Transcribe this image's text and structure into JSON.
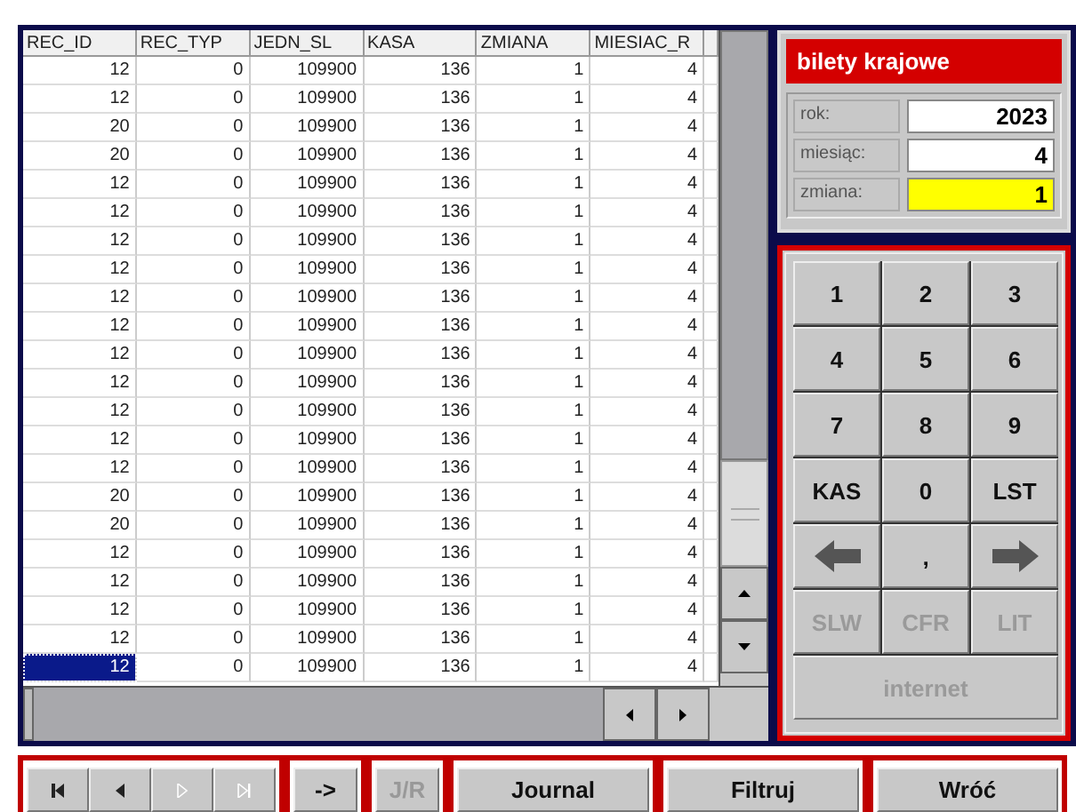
{
  "table": {
    "columns": [
      "REC_ID",
      "REC_TYP",
      "JEDN_SL",
      "KASA",
      "ZMIANA",
      "MIESIAC_R"
    ],
    "rows": [
      {
        "cells": [
          "12",
          "0",
          "109900",
          "136",
          "1",
          "4"
        ],
        "selected": false
      },
      {
        "cells": [
          "12",
          "0",
          "109900",
          "136",
          "1",
          "4"
        ],
        "selected": false
      },
      {
        "cells": [
          "20",
          "0",
          "109900",
          "136",
          "1",
          "4"
        ],
        "selected": false
      },
      {
        "cells": [
          "20",
          "0",
          "109900",
          "136",
          "1",
          "4"
        ],
        "selected": false
      },
      {
        "cells": [
          "12",
          "0",
          "109900",
          "136",
          "1",
          "4"
        ],
        "selected": false
      },
      {
        "cells": [
          "12",
          "0",
          "109900",
          "136",
          "1",
          "4"
        ],
        "selected": false
      },
      {
        "cells": [
          "12",
          "0",
          "109900",
          "136",
          "1",
          "4"
        ],
        "selected": false
      },
      {
        "cells": [
          "12",
          "0",
          "109900",
          "136",
          "1",
          "4"
        ],
        "selected": false
      },
      {
        "cells": [
          "12",
          "0",
          "109900",
          "136",
          "1",
          "4"
        ],
        "selected": false
      },
      {
        "cells": [
          "12",
          "0",
          "109900",
          "136",
          "1",
          "4"
        ],
        "selected": false
      },
      {
        "cells": [
          "12",
          "0",
          "109900",
          "136",
          "1",
          "4"
        ],
        "selected": false
      },
      {
        "cells": [
          "12",
          "0",
          "109900",
          "136",
          "1",
          "4"
        ],
        "selected": false
      },
      {
        "cells": [
          "12",
          "0",
          "109900",
          "136",
          "1",
          "4"
        ],
        "selected": false
      },
      {
        "cells": [
          "12",
          "0",
          "109900",
          "136",
          "1",
          "4"
        ],
        "selected": false
      },
      {
        "cells": [
          "12",
          "0",
          "109900",
          "136",
          "1",
          "4"
        ],
        "selected": false
      },
      {
        "cells": [
          "20",
          "0",
          "109900",
          "136",
          "1",
          "4"
        ],
        "selected": false
      },
      {
        "cells": [
          "20",
          "0",
          "109900",
          "136",
          "1",
          "4"
        ],
        "selected": false
      },
      {
        "cells": [
          "12",
          "0",
          "109900",
          "136",
          "1",
          "4"
        ],
        "selected": false
      },
      {
        "cells": [
          "12",
          "0",
          "109900",
          "136",
          "1",
          "4"
        ],
        "selected": false
      },
      {
        "cells": [
          "12",
          "0",
          "109900",
          "136",
          "1",
          "4"
        ],
        "selected": false
      },
      {
        "cells": [
          "12",
          "0",
          "109900",
          "136",
          "1",
          "4"
        ],
        "selected": false
      },
      {
        "cells": [
          "12",
          "0",
          "109900",
          "136",
          "1",
          "4"
        ],
        "selected": true
      }
    ]
  },
  "panel": {
    "title": "bilety krajowe",
    "fields": [
      {
        "label": "rok:",
        "value": "2023",
        "highlighted": false
      },
      {
        "label": "miesiąc:",
        "value": "4",
        "highlighted": false
      },
      {
        "label": "zmiana:",
        "value": "1",
        "highlighted": true
      }
    ]
  },
  "keypad": [
    {
      "kind": "text",
      "label": "1",
      "disabled": false
    },
    {
      "kind": "text",
      "label": "2",
      "disabled": false
    },
    {
      "kind": "text",
      "label": "3",
      "disabled": false
    },
    {
      "kind": "text",
      "label": "4",
      "disabled": false
    },
    {
      "kind": "text",
      "label": "5",
      "disabled": false
    },
    {
      "kind": "text",
      "label": "6",
      "disabled": false
    },
    {
      "kind": "text",
      "label": "7",
      "disabled": false
    },
    {
      "kind": "text",
      "label": "8",
      "disabled": false
    },
    {
      "kind": "text",
      "label": "9",
      "disabled": false
    },
    {
      "kind": "text",
      "label": "KAS",
      "disabled": false
    },
    {
      "kind": "text",
      "label": "0",
      "disabled": false
    },
    {
      "kind": "text",
      "label": "LST",
      "disabled": false
    },
    {
      "kind": "left",
      "disabled": false
    },
    {
      "kind": "text",
      "label": ",",
      "disabled": false
    },
    {
      "kind": "right",
      "disabled": false
    },
    {
      "kind": "text",
      "label": "SLW",
      "disabled": true
    },
    {
      "kind": "text",
      "label": "CFR",
      "disabled": true
    },
    {
      "kind": "text",
      "label": "LIT",
      "disabled": true
    },
    {
      "kind": "wide",
      "label": "internet",
      "disabled": true
    }
  ],
  "navigator": [
    {
      "kind": "first",
      "disabled": false
    },
    {
      "kind": "prev",
      "disabled": false
    },
    {
      "kind": "next",
      "disabled": true
    },
    {
      "kind": "last",
      "disabled": true
    }
  ],
  "buttons": [
    {
      "label": "->",
      "disabled": false
    },
    {
      "label": "J/R",
      "disabled": true
    },
    {
      "label": "Journal",
      "disabled": false
    },
    {
      "label": "Filtruj",
      "disabled": false
    },
    {
      "label": "Wróć",
      "disabled": false
    }
  ]
}
